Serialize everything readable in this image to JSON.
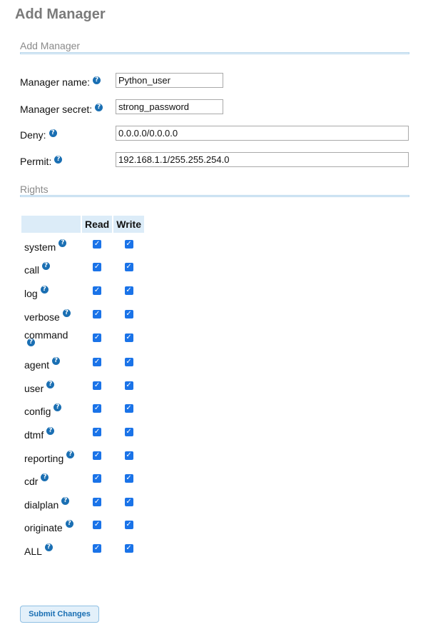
{
  "page": {
    "title": "Add Manager"
  },
  "sections": {
    "manager": "Add Manager",
    "rights": "Rights"
  },
  "fields": [
    {
      "label": "Manager name:",
      "value": "Python_user"
    },
    {
      "label": "Manager secret:",
      "value": "strong_password"
    },
    {
      "label": "Deny:",
      "value": "0.0.0.0/0.0.0.0"
    },
    {
      "label": "Permit:",
      "value": "192.168.1.1/255.255.254.0"
    }
  ],
  "rights_table": {
    "headers": {
      "blank": "",
      "read": "Read",
      "write": "Write"
    },
    "rows": [
      {
        "name": "system",
        "read": true,
        "write": true
      },
      {
        "name": "call",
        "read": true,
        "write": true
      },
      {
        "name": "log",
        "read": true,
        "write": true
      },
      {
        "name": "verbose",
        "read": true,
        "write": true
      },
      {
        "name": "command",
        "read": true,
        "write": true
      },
      {
        "name": "agent",
        "read": true,
        "write": true
      },
      {
        "name": "user",
        "read": true,
        "write": true
      },
      {
        "name": "config",
        "read": true,
        "write": true
      },
      {
        "name": "dtmf",
        "read": true,
        "write": true
      },
      {
        "name": "reporting",
        "read": true,
        "write": true
      },
      {
        "name": "cdr",
        "read": true,
        "write": true
      },
      {
        "name": "dialplan",
        "read": true,
        "write": true
      },
      {
        "name": "originate",
        "read": true,
        "write": true
      },
      {
        "name": "ALL",
        "read": true,
        "write": true
      }
    ]
  },
  "buttons": {
    "submit": "Submit Changes"
  },
  "icons": {
    "help": "question-mark-help-icon",
    "help_glyph": "?",
    "check_glyph": "✓"
  },
  "colors": {
    "accent": "#1a6fb3",
    "checkbox": "#1a73e8",
    "header_bg": "#dcecf8",
    "title": "#7a7a7a"
  }
}
